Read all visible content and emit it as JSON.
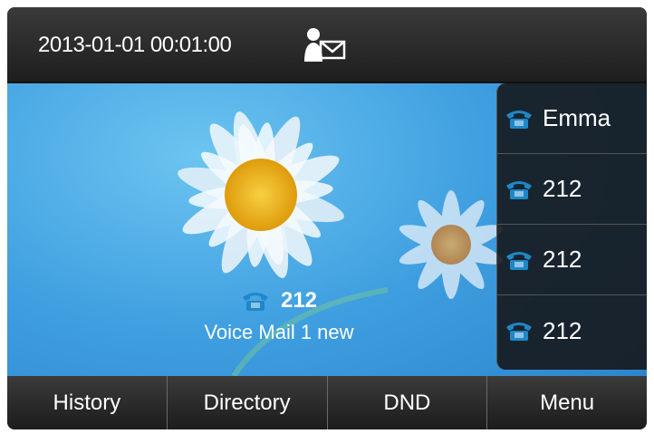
{
  "statusbar": {
    "datetime": "2013-01-01 00:01:00",
    "icon": "contact-message-icon"
  },
  "accounts": [
    {
      "label": "Emma",
      "icon": "phone-icon"
    },
    {
      "label": "212",
      "icon": "phone-icon"
    },
    {
      "label": "212",
      "icon": "phone-icon"
    },
    {
      "label": "212",
      "icon": "phone-icon"
    }
  ],
  "voicemail": {
    "number": "212",
    "text": "Voice Mail  1 new",
    "icon": "phone-icon"
  },
  "softkeys": [
    "History",
    "Directory",
    "DND",
    "Menu"
  ],
  "colors": {
    "accent_icon": "#1e88c8",
    "bar_background": "#2a2a2a",
    "text": "#ffffff"
  }
}
